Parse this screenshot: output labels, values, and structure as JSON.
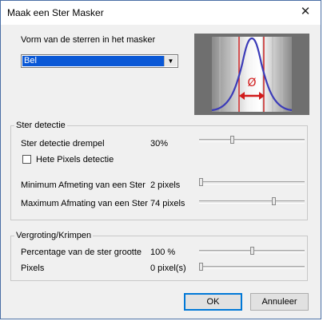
{
  "window": {
    "title": "Maak een Ster Masker",
    "close_icon": "close-icon"
  },
  "shape": {
    "label": "Vorm van de sterren in het masker",
    "selected": "Bel",
    "preview_symbol": "Ø"
  },
  "star_detection": {
    "group_label": "Ster detectie",
    "threshold_label": "Ster detectie drempel",
    "threshold_value": "30%",
    "threshold_fraction": 0.31,
    "hot_pixels_label": "Hete Pixels detectie",
    "hot_pixels_checked": false,
    "min_size_label": "Minimum Afmeting van een Ster",
    "min_size_value": "2 pixels",
    "min_size_fraction": 0.0,
    "max_size_label": "Maximum Afmating van een Ster",
    "max_size_value": "74 pixels",
    "max_size_fraction": 0.72
  },
  "scaling": {
    "group_label": "Vergroting/Krimpen",
    "percentage_label": "Percentage van de ster grootte",
    "percentage_value": "100 %",
    "percentage_fraction": 0.5,
    "pixels_label": "Pixels",
    "pixels_value": "0 pixel(s)",
    "pixels_fraction": 0.0
  },
  "buttons": {
    "ok": "OK",
    "cancel": "Annuleer"
  },
  "colors": {
    "selection": "#0a58d6",
    "curve": "#3b3bb8",
    "marker": "#d11b1b"
  }
}
